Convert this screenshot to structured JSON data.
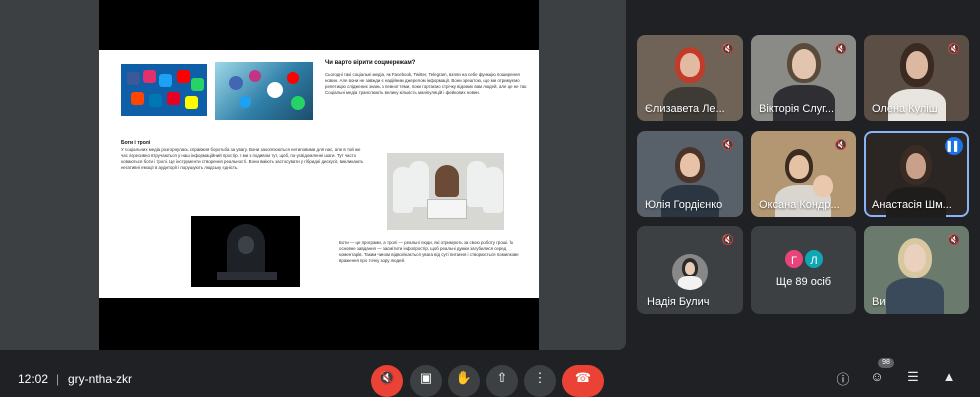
{
  "slide": {
    "title": "Чи варто вірити соцмережам?",
    "para1": "Сьогодні такі соціальні медіа, як Facebook, Twitter, Telegram, взяли на себе функцію поширення новин. Але вони не завжди є надійним джерелом інформації. Вони зрештою, що ми отримуємо репетицію сліджених знань з певної теми, поки гортаємо стрічку відомих вам людей, але це не так. Соціальні медіа транслюють велику кількість маніпуляцій і фейкових новин.",
    "heading2": "Боти і тролі",
    "para2": "У соціальних медіа розгорнулась справжня боротьба за увагу. Вони захоплюються нетиповими для нас, але в той же час агресивно втручаються у наш інформаційний простір. І ми з подивом тут, щоб, по-усвідомленні шаги. Тут часто ховаються боти і тролі. Це інструменти створення реальності. Вони вміють застосувати у гібридні дискусії, викликають негативні емоції в аудиторії і порушують людську єдність.",
    "para3": "Боти — це програми, а тролі — реальні люди, які отримують за свою роботу гроші. Їх основне завдання — засмітити інфопростір, щоб реальні думки загубилися серед коментарів. Таким чином відволікається увага від суті питання і створюється помилкове враження про точку зору людей."
  },
  "participants": [
    {
      "name": "Єлизавета Ле..."
    },
    {
      "name": "Вікторія Слуг..."
    },
    {
      "name": "Олена Куліш"
    },
    {
      "name": "Юлія Гордієнко"
    },
    {
      "name": "Оксана Кондр..."
    },
    {
      "name": "Анастасія Шм..."
    },
    {
      "name": "Надія Булич"
    },
    {
      "name": "Ви"
    }
  ],
  "more": {
    "label": "Ще 89 осіб",
    "initials": [
      "Г",
      "Л"
    ]
  },
  "meeting": {
    "time": "12:02",
    "separator": "|",
    "code": "gry-ntha-zkr"
  },
  "people_count": "98",
  "icons": {
    "mic_off": "mic-off-icon",
    "camera": "camera-icon",
    "hand": "raise-hand-icon",
    "present": "present-icon",
    "more": "more-options-icon",
    "hangup": "hang-up-icon",
    "info": "info-icon",
    "people": "people-icon",
    "chat": "chat-icon",
    "activities": "activities-icon"
  },
  "colors": {
    "accent": "#1a73e8",
    "danger": "#ea4335",
    "bg": "#202124"
  }
}
